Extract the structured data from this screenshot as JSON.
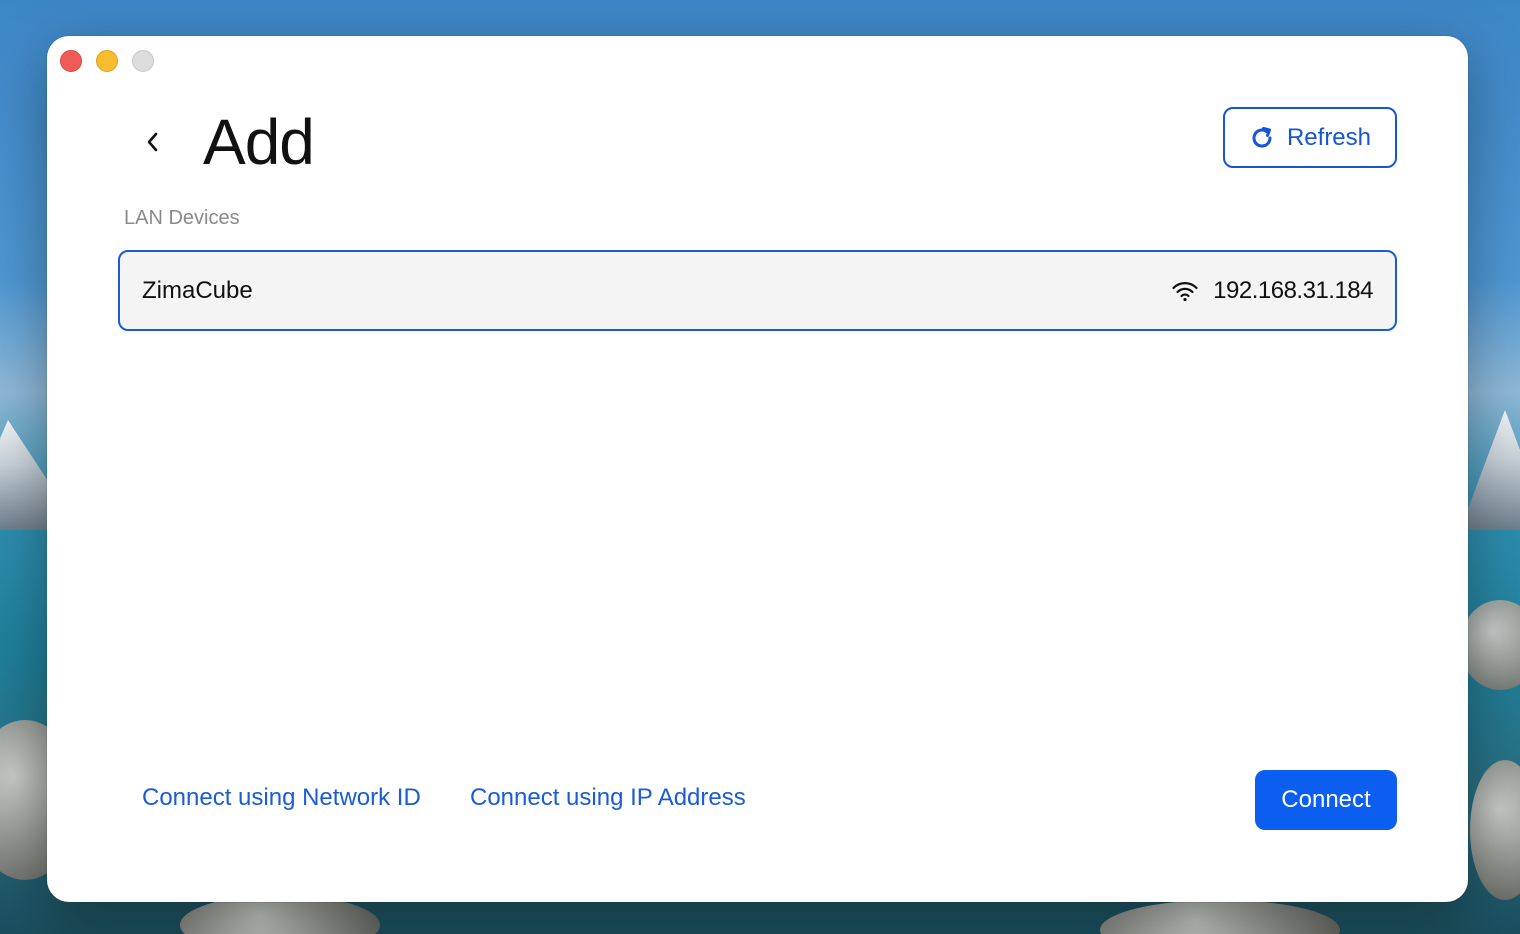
{
  "window": {
    "title": "Add"
  },
  "header": {
    "refresh_label": "Refresh"
  },
  "lan": {
    "section_label": "LAN Devices",
    "devices": [
      {
        "name": "ZimaCube",
        "ip": "192.168.31.184",
        "connection_icon": "wifi-icon",
        "selected": true
      }
    ]
  },
  "footer": {
    "network_id_link": "Connect using Network ID",
    "ip_address_link": "Connect using IP Address",
    "connect_label": "Connect"
  },
  "colors": {
    "accent": "#1455d9",
    "primary_button": "#0b5ef0",
    "selected_border": "#1a5cd7"
  }
}
